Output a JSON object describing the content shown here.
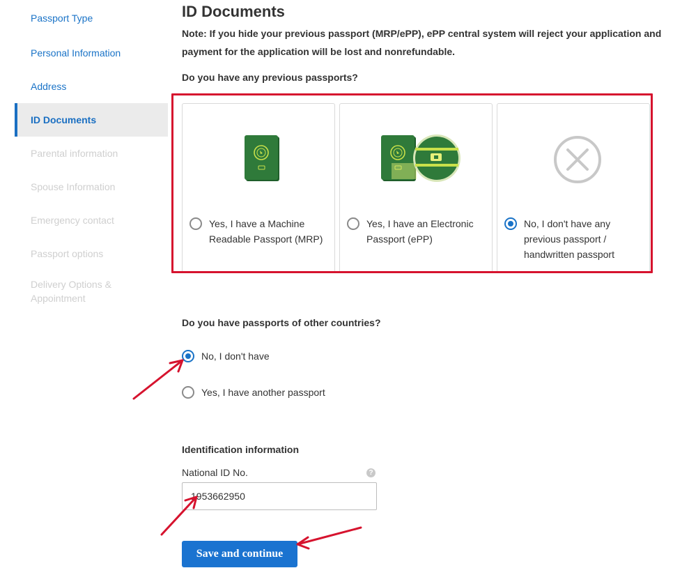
{
  "sidebar": {
    "items": [
      {
        "label": "Passport Type"
      },
      {
        "label": "Personal Information"
      },
      {
        "label": "Address"
      },
      {
        "label": "ID Documents"
      },
      {
        "label": "Parental information"
      },
      {
        "label": "Spouse Information"
      },
      {
        "label": "Emergency contact"
      },
      {
        "label": "Passport options"
      },
      {
        "label": "Delivery Options & Appointment"
      }
    ],
    "active_index": 3
  },
  "main": {
    "title": "ID Documents",
    "note": "Note: If you hide your previous passport (MRP/ePP), ePP central system will reject your application and payment for the application will be lost and nonrefundable.",
    "previous_passport_question": "Do you have any previous passports?",
    "previous_passport_options": [
      {
        "label": "Yes, I have a Machine Readable Passport (MRP)",
        "icon": "mrp-passport-icon",
        "selected": false
      },
      {
        "label": "Yes, I have an Electronic Passport (ePP)",
        "icon": "epp-passport-icon",
        "selected": false
      },
      {
        "label": "No, I don't have any previous passport / handwritten passport",
        "icon": "no-passport-icon",
        "selected": true
      }
    ],
    "other_countries_question": "Do you have passports of other countries?",
    "other_countries_options": [
      {
        "label": "No, I don't have",
        "selected": true
      },
      {
        "label": "Yes, I have another passport",
        "selected": false
      }
    ],
    "identification_title": "Identification information",
    "national_id_label": "National ID No.",
    "national_id_value": "1953662950",
    "help_icon_glyph": "?",
    "save_button_label": "Save and continue"
  },
  "colors": {
    "link": "#1a73c7",
    "primary_button": "#1a73d0",
    "annotation_red": "#d6132e",
    "passport_green": "#2f7a3a"
  }
}
